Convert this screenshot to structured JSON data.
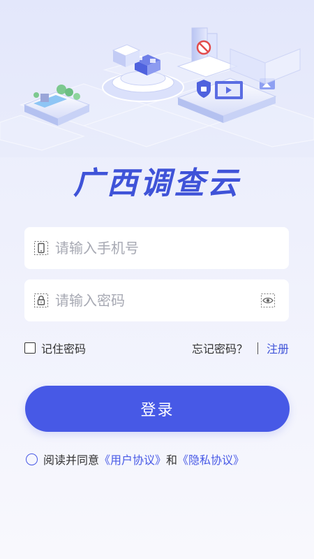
{
  "brand": {
    "title": "广西调查云"
  },
  "login_form": {
    "phone_placeholder": "请输入手机号",
    "password_placeholder": "请输入密码",
    "remember_label": "记住密码",
    "forgot_label": "忘记密码？",
    "register_label": "注册",
    "login_label": "登录"
  },
  "agreement": {
    "prefix": "阅读并同意",
    "user_agreement": "《用户协议》",
    "conjunction": "和",
    "privacy_policy": "《隐私协议》"
  },
  "colors": {
    "accent": "#4759e6",
    "brand_title": "#3f53d8",
    "background_top": "#e9ecfb",
    "background_bottom": "#f8f8fd"
  },
  "icons": {
    "phone_field": "smartphone-icon",
    "password_field": "lock-icon",
    "password_toggle": "eye-icon"
  }
}
